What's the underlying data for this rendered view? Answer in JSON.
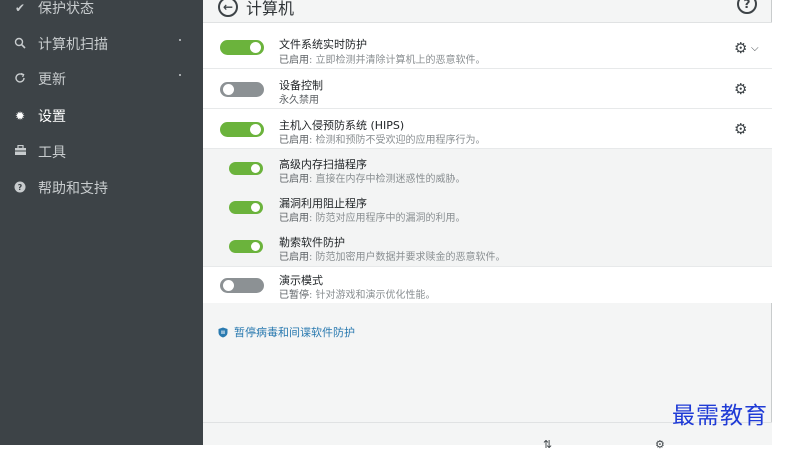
{
  "sidebar": {
    "items": [
      {
        "label": "保护状态",
        "icon": "check-icon"
      },
      {
        "label": "计算机扫描",
        "icon": "search-icon"
      },
      {
        "label": "更新",
        "icon": "refresh-icon"
      },
      {
        "label": "设置",
        "icon": "gear-icon"
      },
      {
        "label": "工具",
        "icon": "toolbox-icon"
      },
      {
        "label": "帮助和支持",
        "icon": "help-icon"
      }
    ]
  },
  "header": {
    "title": "计算机"
  },
  "rows": [
    {
      "title": "文件系统实时防护",
      "status": "已启用",
      "desc": ": 立即检测并清除计算机上的恶意软件。",
      "enabled": true
    },
    {
      "title": "设备控制",
      "status": "永久禁用",
      "desc": "",
      "enabled": false
    },
    {
      "title": "主机入侵预防系统 (HIPS)",
      "status": "已启用",
      "desc": ": 检测和预防不受欢迎的应用程序行为。",
      "enabled": true
    },
    {
      "title": "高级内存扫描程序",
      "status": "已启用",
      "desc": ": 直接在内存中检测迷惑性的威胁。",
      "enabled": true
    },
    {
      "title": "漏洞利用阻止程序",
      "status": "已启用",
      "desc": ": 防范对应用程序中的漏洞的利用。",
      "enabled": true
    },
    {
      "title": "勒索软件防护",
      "status": "已启用",
      "desc": ": 防范加密用户数据并要求赎金的恶意软件。",
      "enabled": true
    },
    {
      "title": "演示模式",
      "status": "已暂停",
      "desc": ": 针对游戏和演示优化性能。",
      "enabled": false
    }
  ],
  "pause_link": "暂停病毒和间谍软件防护",
  "watermark": "最需教育",
  "colors": {
    "accent_green": "#6bb33c",
    "sidebar": "#3d4347",
    "link": "#2a7ab0"
  }
}
